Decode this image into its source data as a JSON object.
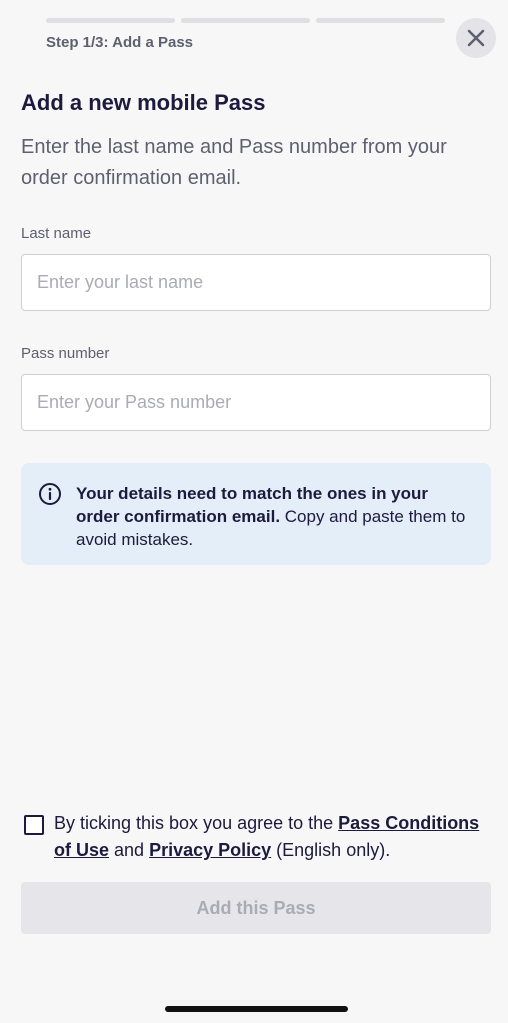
{
  "header": {
    "step_label": "Step 1/3: Add a Pass",
    "progress_steps": 3,
    "current_step": 1
  },
  "title": "Add a new mobile Pass",
  "subtitle": "Enter the last name and Pass number from your order confirmation email.",
  "form": {
    "last_name": {
      "label": "Last name",
      "placeholder": "Enter your last name",
      "value": ""
    },
    "pass_number": {
      "label": "Pass number",
      "placeholder": "Enter your Pass number",
      "value": ""
    }
  },
  "info": {
    "bold_text": "Your details need to match the ones in your order confirmation email.",
    "text": " Copy and paste them to avoid mistakes.",
    "icon": "info-icon"
  },
  "consent": {
    "checked": false,
    "prefix": "By ticking this box you agree to the ",
    "link1": "Pass Conditions of Use",
    "middle": " and ",
    "link2": "Privacy Policy",
    "suffix": " (English only)."
  },
  "submit_label": "Add this Pass",
  "colors": {
    "primary_text": "#1d1a3d",
    "secondary_text": "#5f5f70",
    "info_background": "#e3eef8",
    "disabled_button": "#e6e6ea"
  }
}
